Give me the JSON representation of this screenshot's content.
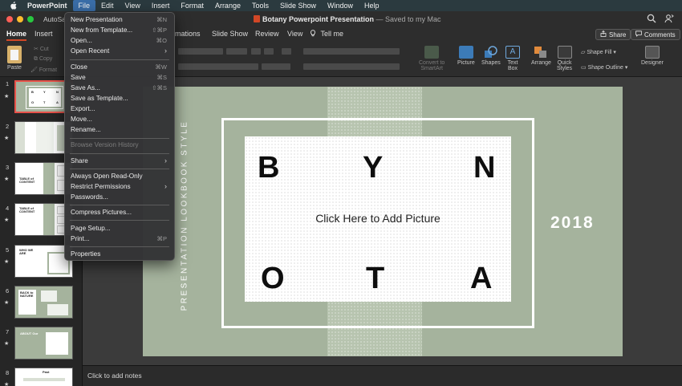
{
  "menubar": {
    "app": "PowerPoint",
    "items": [
      "File",
      "Edit",
      "View",
      "Insert",
      "Format",
      "Arrange",
      "Tools",
      "Slide Show",
      "Window",
      "Help"
    ]
  },
  "titlebar": {
    "autosave": "AutoSav",
    "doc_name": "Botany Powerpoint Presentation",
    "doc_status": " — Saved to my Mac"
  },
  "ribbon_tabs": {
    "home": "Home",
    "insert": "Insert",
    "animations": "mations",
    "slideshow": "Slide Show",
    "review": "Review",
    "view": "View",
    "tellme": "Tell me",
    "share": "Share",
    "comments": "Comments"
  },
  "ribbon": {
    "paste": "Paste",
    "cut": "Cut",
    "copy": "Copy",
    "format": "Format",
    "convert1": "Convert to",
    "convert2": "SmartArt",
    "picture": "Picture",
    "shapes": "Shapes",
    "textbox1": "Text",
    "textbox2": "Box",
    "arrange": "Arrange",
    "quick1": "Quick",
    "quick2": "Styles",
    "shape_fill": "Shape Fill",
    "shape_outline": "Shape Outline",
    "designer": "Designer"
  },
  "file_menu": [
    {
      "label": "New Presentation",
      "shortcut": "⌘N"
    },
    {
      "label": "New from Template...",
      "shortcut": "⇧⌘P"
    },
    {
      "label": "Open...",
      "shortcut": "⌘O"
    },
    {
      "label": "Open Recent",
      "arrow": "›"
    },
    {
      "label": "Close",
      "shortcut": "⌘W"
    },
    {
      "label": "Save",
      "shortcut": "⌘S"
    },
    {
      "label": "Save As...",
      "shortcut": "⇧⌘S"
    },
    {
      "label": "Save as Template..."
    },
    {
      "label": "Export..."
    },
    {
      "label": "Move..."
    },
    {
      "label": "Rename..."
    },
    {
      "label": "Browse Version History"
    },
    {
      "label": "Share",
      "arrow": "›"
    },
    {
      "label": "Always Open Read-Only"
    },
    {
      "label": "Restrict Permissions",
      "arrow": "›"
    },
    {
      "label": "Passwords..."
    },
    {
      "label": "Compress Pictures..."
    },
    {
      "label": "Page Setup..."
    },
    {
      "label": "Print...",
      "shortcut": "⌘P"
    },
    {
      "label": "Properties"
    }
  ],
  "thumbnails": {
    "numbers": [
      "1",
      "2",
      "3",
      "4",
      "5",
      "6",
      "7",
      "8"
    ],
    "star": "★",
    "t1_letters": [
      "B",
      "Y",
      "N",
      "O",
      "T",
      "A"
    ],
    "t3": "TABLE of CONTENT",
    "t4": "TABLE of CONTENT",
    "t5": "WHO WE ARE",
    "t6": "BACK to NATURE",
    "t7": "ABOUT Our",
    "t8": "Past"
  },
  "slide": {
    "letters": [
      "B",
      "Y",
      "N",
      "O",
      "T",
      "A"
    ],
    "placeholder": "Click Here to Add Picture",
    "year": "2018",
    "vertical": "PRESENTATION LOOKBOOK STYLE",
    "colors": {
      "bg": "#a5b39d",
      "stripe": "#b7c4af",
      "accent": "#ffffff"
    }
  },
  "notes": {
    "placeholder": "Click to add notes"
  }
}
